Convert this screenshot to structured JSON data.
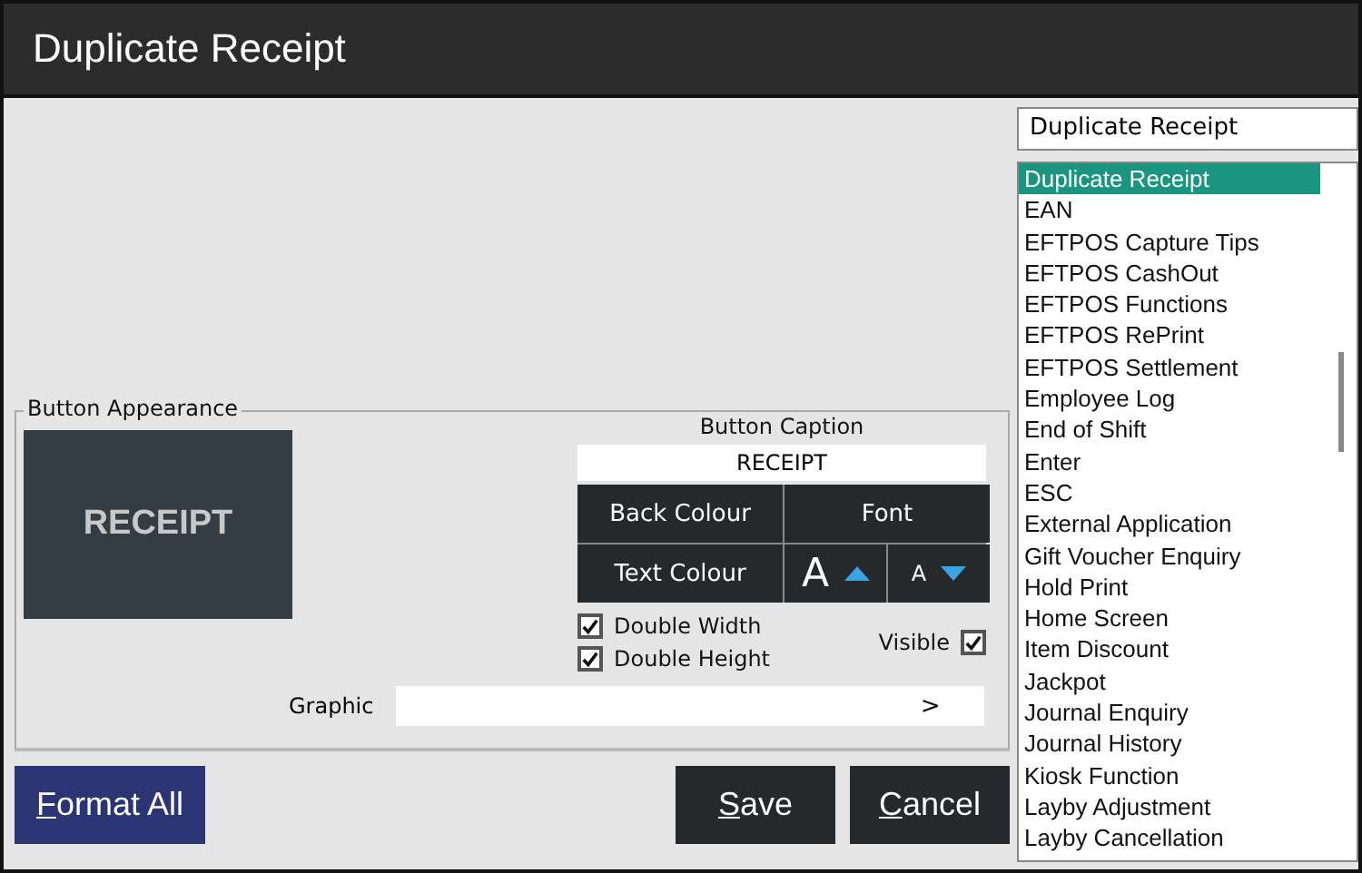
{
  "window": {
    "title": "Duplicate Receipt"
  },
  "appearance": {
    "legend": "Button Appearance",
    "preview_caption": "RECEIPT",
    "caption_label": "Button Caption",
    "caption_value": "RECEIPT",
    "buttons": [
      {
        "kind": "text",
        "label": "Back Colour"
      },
      {
        "kind": "text",
        "label": "Font"
      },
      {
        "kind": "text",
        "label": "Text Colour"
      },
      {
        "kind": "size-up",
        "label": "A"
      },
      {
        "kind": "size-down",
        "label": "A"
      }
    ],
    "options": [
      {
        "label": "Double Width",
        "checked": true
      },
      {
        "label": "Double Height",
        "checked": true
      }
    ],
    "visible": {
      "label": "Visible",
      "checked": true
    },
    "graphic": {
      "label": "Graphic",
      "browse": ">"
    }
  },
  "actions": [
    {
      "label": "Format All",
      "kind": "primary"
    },
    {
      "label": "Save",
      "kind": "dark"
    },
    {
      "label": "Cancel",
      "kind": "dark"
    }
  ],
  "function_list": {
    "filter": "Duplicate Receipt",
    "items": [
      {
        "label": "Duplicate Receipt",
        "selected": true
      },
      {
        "label": "EAN",
        "selected": false
      },
      {
        "label": "EFTPOS Capture Tips",
        "selected": false
      },
      {
        "label": "EFTPOS CashOut",
        "selected": false
      },
      {
        "label": "EFTPOS Functions",
        "selected": false
      },
      {
        "label": "EFTPOS RePrint",
        "selected": false
      },
      {
        "label": "EFTPOS Settlement",
        "selected": false
      },
      {
        "label": "Employee Log",
        "selected": false
      },
      {
        "label": "End of Shift",
        "selected": false
      },
      {
        "label": "Enter",
        "selected": false
      },
      {
        "label": "ESC",
        "selected": false
      },
      {
        "label": "External Application",
        "selected": false
      },
      {
        "label": "Gift Voucher Enquiry",
        "selected": false
      },
      {
        "label": "Hold Print",
        "selected": false
      },
      {
        "label": "Home Screen",
        "selected": false
      },
      {
        "label": "Item Discount",
        "selected": false
      },
      {
        "label": "Jackpot",
        "selected": false
      },
      {
        "label": "Journal Enquiry",
        "selected": false
      },
      {
        "label": "Journal History",
        "selected": false
      },
      {
        "label": "Kiosk Function",
        "selected": false
      },
      {
        "label": "Layby Adjustment",
        "selected": false
      },
      {
        "label": "Layby Cancellation",
        "selected": false
      }
    ]
  }
}
